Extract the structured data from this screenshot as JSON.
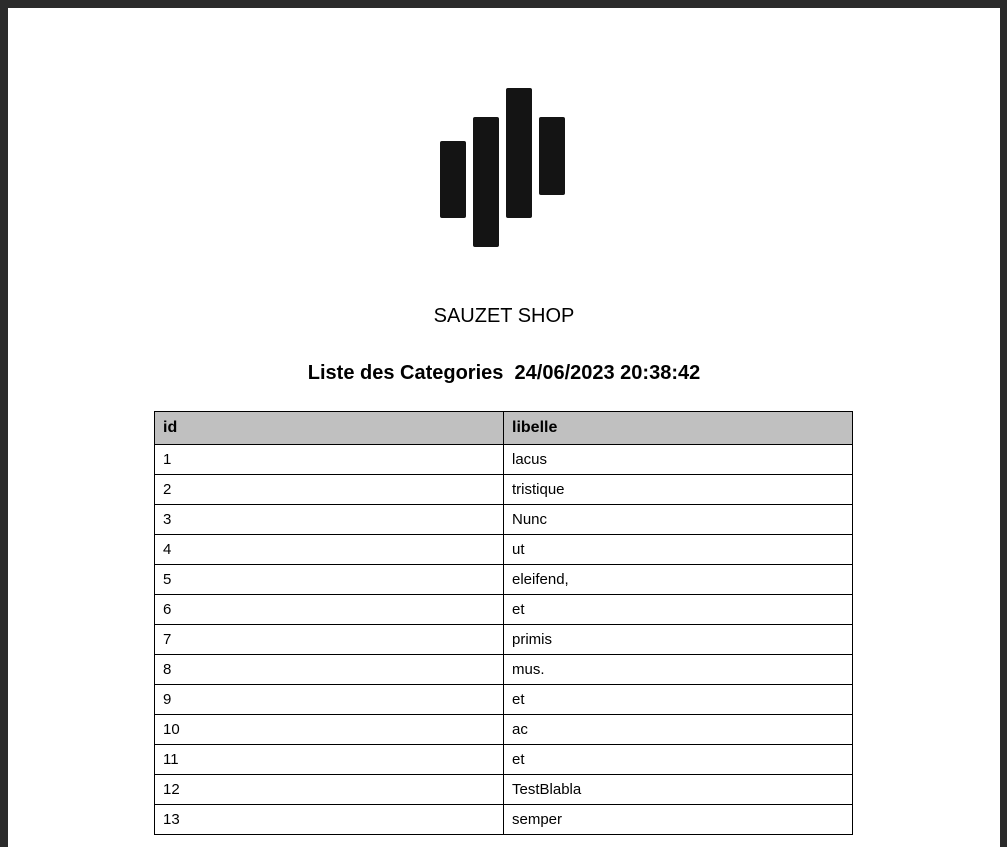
{
  "shop_name": "SAUZET SHOP",
  "document": {
    "title": "Liste des Categories",
    "timestamp": "24/06/2023 20:38:42"
  },
  "table": {
    "headers": [
      "id",
      "libelle"
    ],
    "rows": [
      [
        "1",
        "lacus"
      ],
      [
        "2",
        "tristique"
      ],
      [
        "3",
        "Nunc"
      ],
      [
        "4",
        "ut"
      ],
      [
        "5",
        "eleifend,"
      ],
      [
        "6",
        "et"
      ],
      [
        "7",
        "primis"
      ],
      [
        "8",
        "mus."
      ],
      [
        "9",
        "et"
      ],
      [
        "10",
        "ac"
      ],
      [
        "11",
        "et"
      ],
      [
        "12",
        "TestBlabla"
      ],
      [
        "13",
        "semper"
      ]
    ]
  },
  "colors": {
    "header_bg": "#c0c0c0",
    "viewer_bg": "#2b2b2b",
    "logo": "#141414"
  }
}
